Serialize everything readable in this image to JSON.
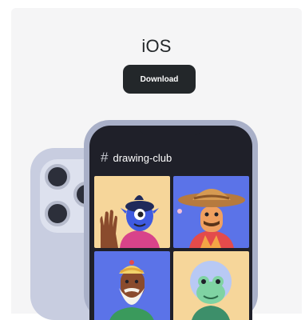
{
  "header": {
    "title": "iOS",
    "download_label": "Download"
  },
  "phone": {
    "channel_icon": "hash-icon",
    "channel_name": "drawing-club",
    "tiles": [
      {
        "bg": "#f6d69a",
        "avatar": "blue-cyclops-avatar"
      },
      {
        "bg": "#5b73e8",
        "avatar": "straw-hat-avatar"
      },
      {
        "bg": "#5b73e8",
        "avatar": "bearded-elder-avatar"
      },
      {
        "bg": "#f6d69a",
        "avatar": "frog-avatar"
      }
    ]
  },
  "colors": {
    "page_bg": "#f5f5f6",
    "button_bg": "#23272a",
    "phone_screen": "#1f2029",
    "tile_yellow": "#f6d69a",
    "tile_blue": "#5b73e8"
  }
}
